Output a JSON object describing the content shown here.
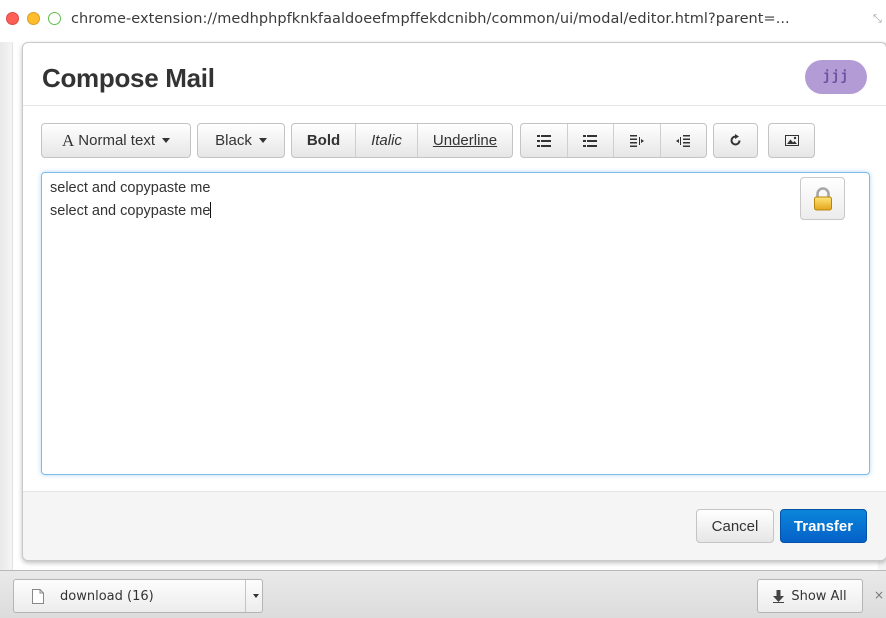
{
  "window": {
    "url": "chrome-extension://medhphpfknkfaaldoeefmpffekdcnibh/common/ui/modal/editor.html?parent=..."
  },
  "modal": {
    "title": "Compose Mail",
    "badge": "jjj"
  },
  "toolbar": {
    "font_style_label": "Normal text",
    "color_label": "Black",
    "bold_label": "Bold",
    "italic_label": "Italic",
    "underline_label": "Underline",
    "icons": [
      "unordered-list-icon",
      "ordered-list-icon",
      "outdent-icon",
      "indent-icon",
      "undo-icon",
      "image-icon"
    ]
  },
  "editor": {
    "lines": [
      "select and copypaste me",
      "select and copypaste me"
    ]
  },
  "footer": {
    "cancel_label": "Cancel",
    "transfer_label": "Transfer"
  },
  "download_shelf": {
    "file_name": "download (16)",
    "show_all_label": "Show All",
    "close_label": "×"
  },
  "colors": {
    "accent": "#0a6fd6",
    "badge_bg": "#b39bd6",
    "editor_focus": "#7fbde9"
  }
}
